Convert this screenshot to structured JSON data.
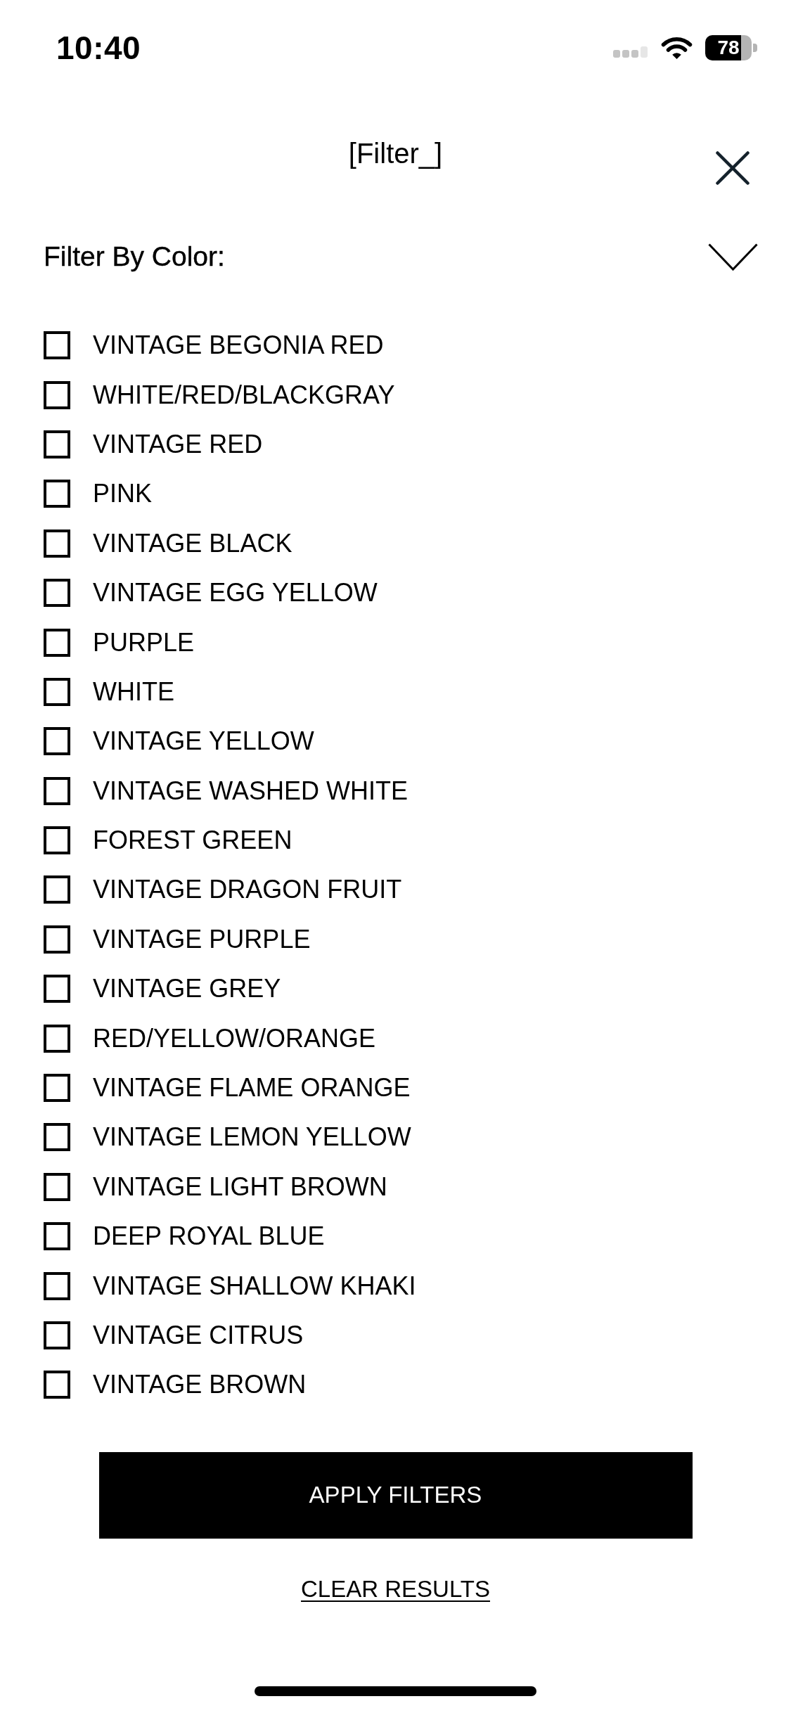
{
  "status_bar": {
    "time": "10:40",
    "battery": "78"
  },
  "header": {
    "title": "[Filter_]"
  },
  "filter": {
    "label": "Filter By Color:",
    "expanded": true
  },
  "colors": [
    {
      "label": "VINTAGE BEGONIA RED",
      "checked": false
    },
    {
      "label": "WHITE/RED/BLACKGRAY",
      "checked": false
    },
    {
      "label": "VINTAGE RED",
      "checked": false
    },
    {
      "label": "PINK",
      "checked": false
    },
    {
      "label": "VINTAGE BLACK",
      "checked": false
    },
    {
      "label": "VINTAGE EGG YELLOW",
      "checked": false
    },
    {
      "label": "PURPLE",
      "checked": false
    },
    {
      "label": "WHITE",
      "checked": false
    },
    {
      "label": "VINTAGE YELLOW",
      "checked": false
    },
    {
      "label": "VINTAGE WASHED WHITE",
      "checked": false
    },
    {
      "label": "FOREST GREEN",
      "checked": false
    },
    {
      "label": "VINTAGE DRAGON FRUIT",
      "checked": false
    },
    {
      "label": "VINTAGE PURPLE",
      "checked": false
    },
    {
      "label": "VINTAGE GREY",
      "checked": false
    },
    {
      "label": "RED/YELLOW/ORANGE",
      "checked": false
    },
    {
      "label": "VINTAGE FLAME ORANGE",
      "checked": false
    },
    {
      "label": "VINTAGE LEMON YELLOW",
      "checked": false
    },
    {
      "label": "VINTAGE LIGHT BROWN",
      "checked": false
    },
    {
      "label": "DEEP ROYAL BLUE",
      "checked": false
    },
    {
      "label": "VINTAGE SHALLOW KHAKI",
      "checked": false
    },
    {
      "label": "VINTAGE CITRUS",
      "checked": false
    },
    {
      "label": "VINTAGE BROWN",
      "checked": false
    }
  ],
  "actions": {
    "apply": "APPLY FILTERS",
    "clear": "CLEAR RESULTS"
  }
}
